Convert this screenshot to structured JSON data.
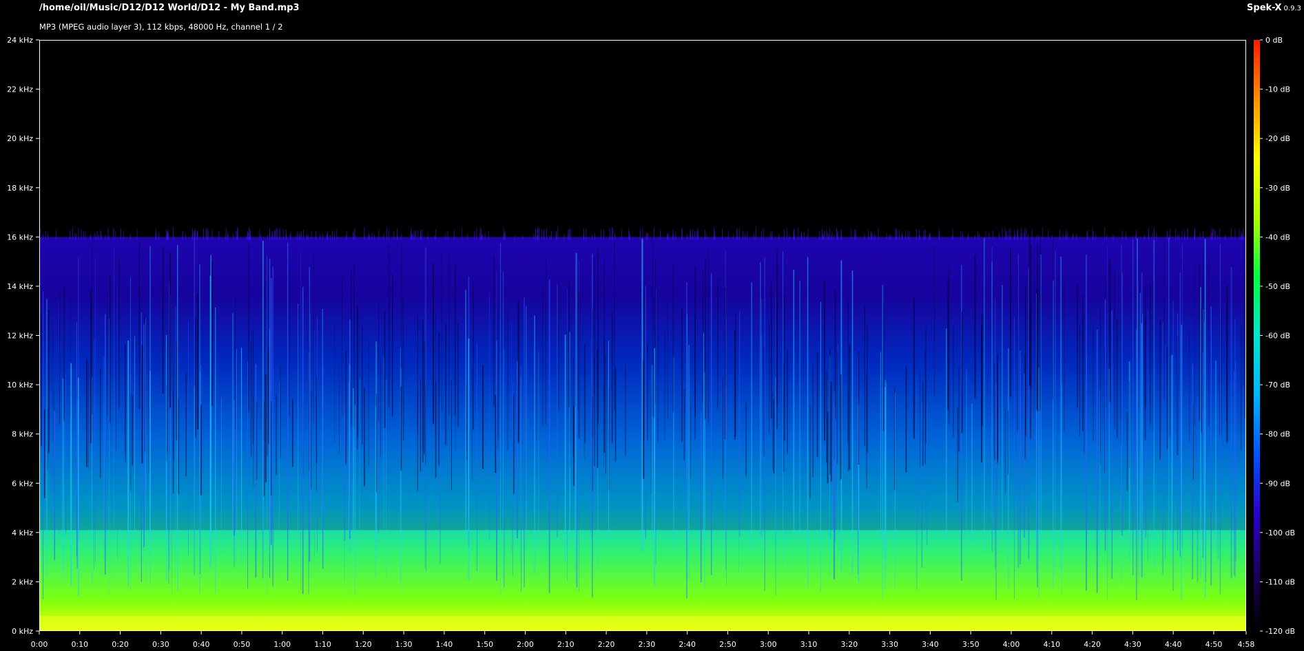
{
  "window": {
    "file_path": "/home/oil/Music/D12/D12 World/D12 - My Band.mp3",
    "stream_info": "MP3 (MPEG audio layer 3), 112 kbps, 48000 Hz, channel 1 / 2",
    "app_name": "Spek-X",
    "app_version": "0.9.3"
  },
  "colors": {
    "background": "#000000",
    "text": "#ffffff",
    "palette": [
      "#000000",
      "#1a0060",
      "#2a00d0",
      "#0055ff",
      "#00b4ff",
      "#00e8d0",
      "#00ff40",
      "#b0ff00",
      "#ffff00",
      "#ff9000",
      "#ff1a00"
    ]
  },
  "chart_data": {
    "type": "heatmap",
    "x_axis": {
      "unit": "time",
      "duration_seconds": 298,
      "ticks": [
        "0:00",
        "0:10",
        "0:20",
        "0:30",
        "0:40",
        "0:50",
        "1:00",
        "1:10",
        "1:20",
        "1:30",
        "1:40",
        "1:50",
        "2:00",
        "2:10",
        "2:20",
        "2:30",
        "2:40",
        "2:50",
        "3:00",
        "3:10",
        "3:20",
        "3:30",
        "3:40",
        "3:50",
        "4:00",
        "4:10",
        "4:20",
        "4:30",
        "4:40",
        "4:50",
        "4:58"
      ]
    },
    "y_axis": {
      "unit": "kHz",
      "range": [
        0,
        24
      ],
      "ticks": [
        "0 kHz",
        "2 kHz",
        "4 kHz",
        "6 kHz",
        "8 kHz",
        "10 kHz",
        "12 kHz",
        "14 kHz",
        "16 kHz",
        "18 kHz",
        "20 kHz",
        "22 kHz",
        "24 kHz"
      ]
    },
    "color_scale": {
      "unit": "dB",
      "range": [
        -120,
        0
      ],
      "ticks": [
        "0 dB",
        "-10 dB",
        "-20 dB",
        "-30 dB",
        "-40 dB",
        "-50 dB",
        "-60 dB",
        "-70 dB",
        "-80 dB",
        "-90 dB",
        "-100 dB",
        "-110 dB",
        "-120 dB"
      ]
    },
    "lowpass_cutoff_khz": 16,
    "shelf_cutoff_khz": 4.1
  }
}
